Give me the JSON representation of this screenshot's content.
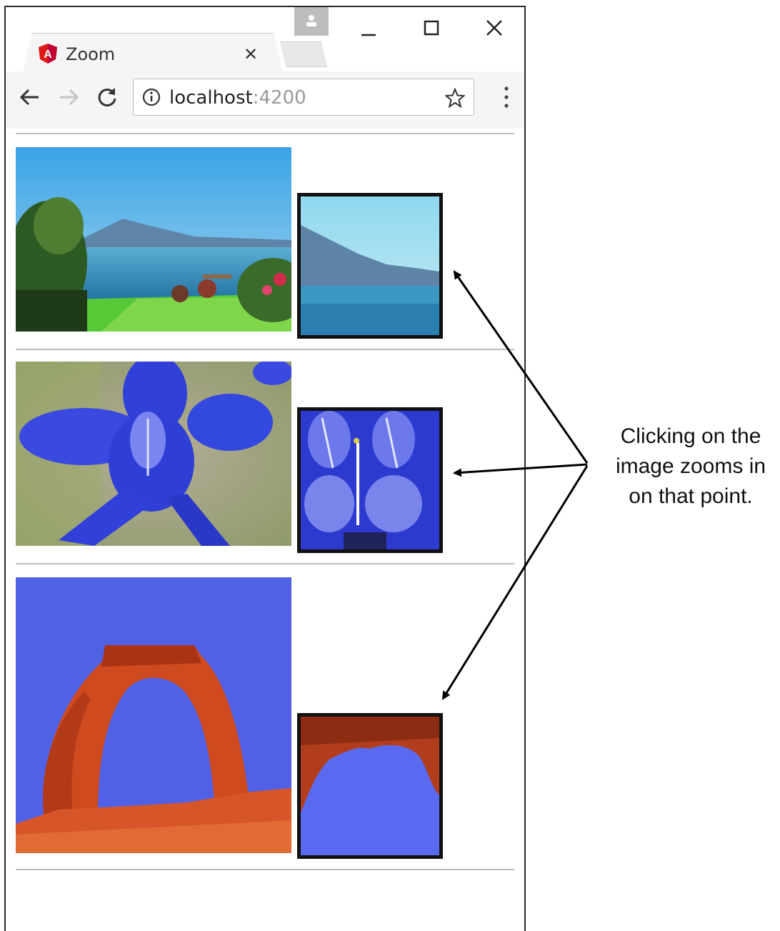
{
  "browser": {
    "tab": {
      "title": "Zoom",
      "close_glyph": "✕"
    },
    "address": {
      "host": "localhost",
      "port": ":4200"
    },
    "icons": [
      "angular-logo-icon",
      "close-icon",
      "user-icon",
      "minimize-icon",
      "maximize-icon",
      "window-close-icon",
      "back-icon",
      "forward-icon",
      "reload-icon",
      "info-icon",
      "star-icon",
      "menu-icon"
    ],
    "colors": {
      "angular_red": "#dd1b16",
      "toolbar": "#f5f5f5"
    }
  },
  "gallery": {
    "items": [
      {
        "subject": "lake and volcano landscape"
      },
      {
        "subject": "blue iris flower"
      },
      {
        "subject": "red rock arch"
      }
    ]
  },
  "annotation": {
    "lines": [
      "Clicking on the",
      "image zooms in",
      "on that point."
    ]
  }
}
